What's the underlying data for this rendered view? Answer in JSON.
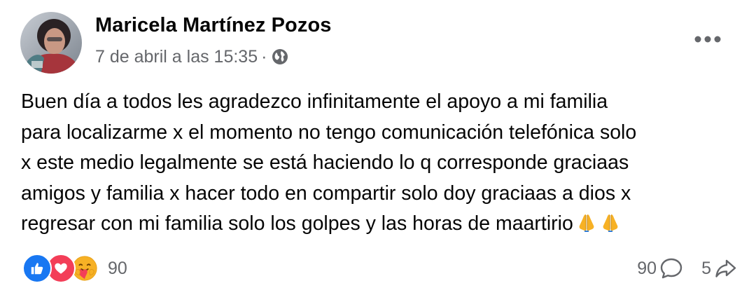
{
  "post": {
    "author": "Maricela Martínez Pozos",
    "timestamp": "7 de abril a las 15:35",
    "separator": "·",
    "privacy_icon": "globe-icon",
    "more_icon": "more-options-icon",
    "text_lines": [
      "Buen día a todos les agradezco infinitamente el apoyo a mi familia",
      "para localizarme x el momento no tengo comunicación telefónica solo",
      "x este medio legalmente se está haciendo lo q corresponde graciaas",
      "amigos y familia x hacer todo en compartir solo doy graciaas a dios x",
      "regresar con mi familia solo los golpes y las horas de maartirio"
    ],
    "trailing_emoji": [
      "folded-hands-emoji",
      "folded-hands-emoji"
    ]
  },
  "reactions": {
    "types": [
      "like",
      "love",
      "care"
    ],
    "count": "90"
  },
  "stats": {
    "comments": "90",
    "comment_icon": "comment-icon",
    "shares": "5",
    "share_icon": "share-icon"
  },
  "colors": {
    "text": "#050505",
    "secondary_text": "#65676b",
    "like_blue": "#1877f2",
    "love_red": "#f33e58",
    "care_yellow": "#f7b125"
  }
}
